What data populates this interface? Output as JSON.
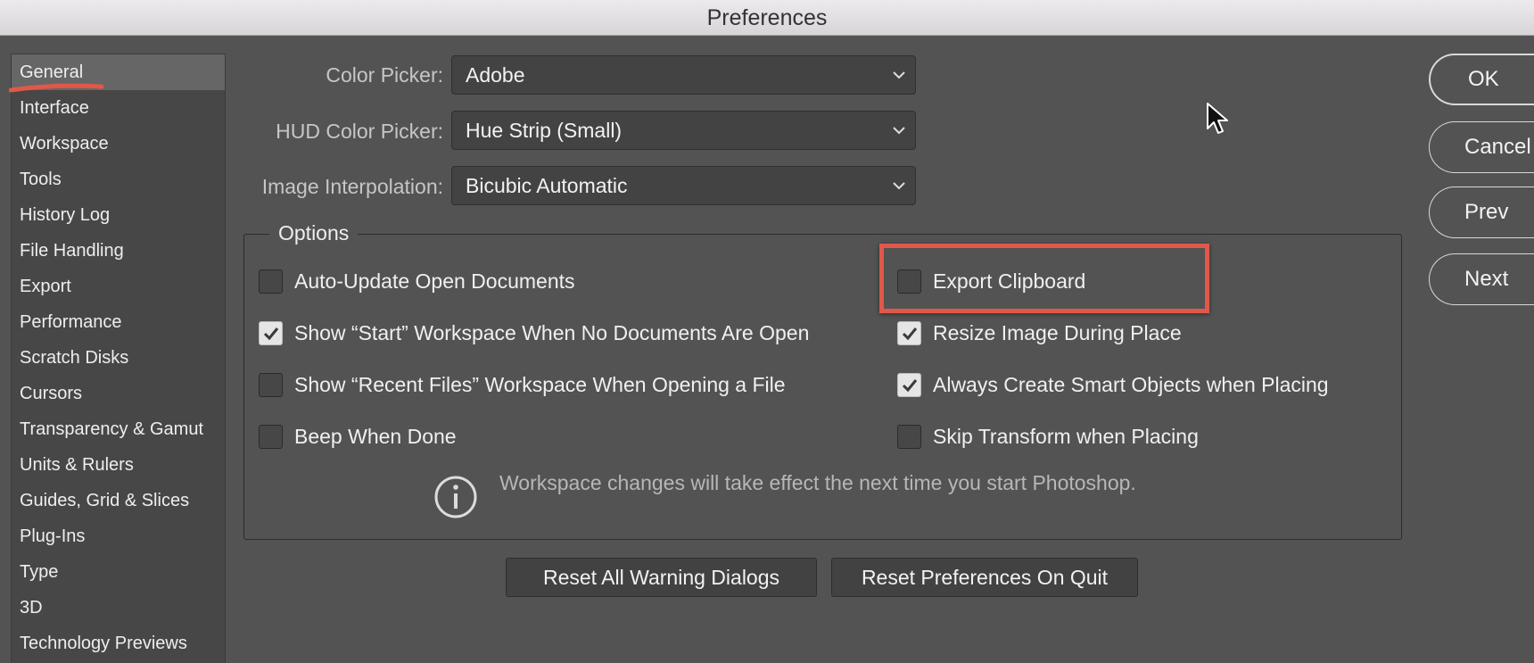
{
  "window": {
    "title": "Preferences"
  },
  "sidebar": {
    "items": [
      {
        "label": "General",
        "selected": true
      },
      {
        "label": "Interface"
      },
      {
        "label": "Workspace"
      },
      {
        "label": "Tools"
      },
      {
        "label": "History Log"
      },
      {
        "label": "File Handling"
      },
      {
        "label": "Export"
      },
      {
        "label": "Performance"
      },
      {
        "label": "Scratch Disks"
      },
      {
        "label": "Cursors"
      },
      {
        "label": "Transparency & Gamut"
      },
      {
        "label": "Units & Rulers"
      },
      {
        "label": "Guides, Grid & Slices"
      },
      {
        "label": "Plug-Ins"
      },
      {
        "label": "Type"
      },
      {
        "label": "3D"
      },
      {
        "label": "Technology Previews"
      }
    ]
  },
  "fields": {
    "color_picker": {
      "label": "Color Picker:",
      "value": "Adobe"
    },
    "hud_color_picker": {
      "label": "HUD Color Picker:",
      "value": "Hue Strip (Small)"
    },
    "image_interpolation": {
      "label": "Image Interpolation:",
      "value": "Bicubic Automatic"
    }
  },
  "options": {
    "legend": "Options",
    "left": [
      {
        "label": "Auto-Update Open Documents",
        "checked": false
      },
      {
        "label": "Show “Start” Workspace When No Documents Are Open",
        "checked": true
      },
      {
        "label": "Show “Recent Files” Workspace When Opening a File",
        "checked": false
      },
      {
        "label": "Beep When Done",
        "checked": false
      }
    ],
    "right": [
      {
        "label": "Export Clipboard",
        "checked": false,
        "highlighted": true
      },
      {
        "label": "Resize Image During Place",
        "checked": true
      },
      {
        "label": "Always Create Smart Objects when Placing",
        "checked": true
      },
      {
        "label": "Skip Transform when Placing",
        "checked": false
      }
    ],
    "info": {
      "icon": "info-icon",
      "text": "Workspace changes will take effect the next time you start Photoshop."
    }
  },
  "buttons": {
    "reset_warnings": "Reset All Warning Dialogs",
    "reset_prefs": "Reset Preferences On Quit",
    "ok": "OK",
    "cancel": "Cancel",
    "prev": "Prev",
    "next": "Next"
  },
  "colors": {
    "background": "#535353",
    "sidebar_bg": "#474747",
    "selected_item": "#666666",
    "annotation_red": "#e05849"
  }
}
